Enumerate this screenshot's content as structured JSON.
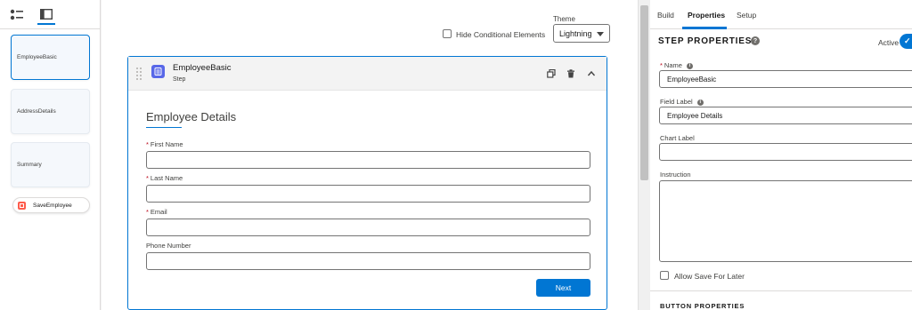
{
  "sidebar": {
    "steps": [
      {
        "label": "EmployeeBasic"
      },
      {
        "label": "AddressDetails"
      },
      {
        "label": "Summary"
      }
    ],
    "action": {
      "label": "SaveEmployee"
    }
  },
  "toolbar": {
    "theme_label": "Theme",
    "theme_value": "Lightning",
    "hide_conditional_label": "Hide Conditional Elements"
  },
  "step": {
    "title": "EmployeeBasic",
    "subtitle": "Step",
    "section_title": "Employee Details",
    "fields": [
      {
        "label": "First Name",
        "required": "*"
      },
      {
        "label": "Last Name",
        "required": "*"
      },
      {
        "label": "Email",
        "required": "*"
      },
      {
        "label": "Phone Number",
        "required": ""
      }
    ],
    "next_label": "Next"
  },
  "panel": {
    "tabs": [
      {
        "label": "Build"
      },
      {
        "label": "Properties"
      },
      {
        "label": "Setup"
      }
    ],
    "title": "STEP PROPERTIES",
    "help_glyph": "?",
    "active_label": "Active",
    "name_label": "Name",
    "name_value": "EmployeeBasic",
    "field_label_label": "Field Label",
    "field_label_value": "Employee Details",
    "chart_label_label": "Chart Label",
    "chart_label_value": "",
    "instruction_label": "Instruction",
    "allow_save_label": "Allow Save For Later",
    "button_properties_title": "BUTTON PROPERTIES",
    "required_mark": "*"
  },
  "colors": {
    "accent": "#0176d3",
    "step_icon": "#5867e8",
    "action_icon": "#fe5c4c",
    "required": "#ba0517"
  }
}
